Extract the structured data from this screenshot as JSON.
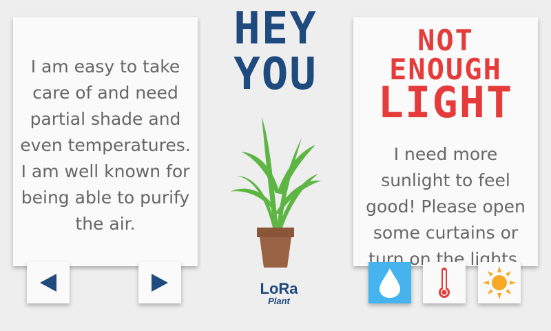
{
  "left_card": {
    "text": "I am easy to take care of and need partial shade and even temperatures. I am well known for being able to purify the air."
  },
  "center": {
    "greeting_line1": "HEY",
    "greeting_line2": "YOU",
    "logo_main": "LoRa",
    "logo_sub": "Plant"
  },
  "right_card": {
    "status_line1": "NOT ENOUGH",
    "status_line2": "LIGHT",
    "text": "I need more sunlight to feel good! Please open some curtains or turn on the lights."
  },
  "buttons": {
    "prev_icon": "left-triangle-icon",
    "next_icon": "right-triangle-icon",
    "water_icon": "water-drop-icon",
    "temperature_icon": "thermometer-icon",
    "light_icon": "sun-icon"
  },
  "colors": {
    "primary_blue": "#1e4a7d",
    "alert_red": "#e53b3b",
    "water_blue": "#45b4ee",
    "leaf_green": "#5db544",
    "pot_brown": "#9a6244",
    "sun_orange": "#f7a824"
  }
}
